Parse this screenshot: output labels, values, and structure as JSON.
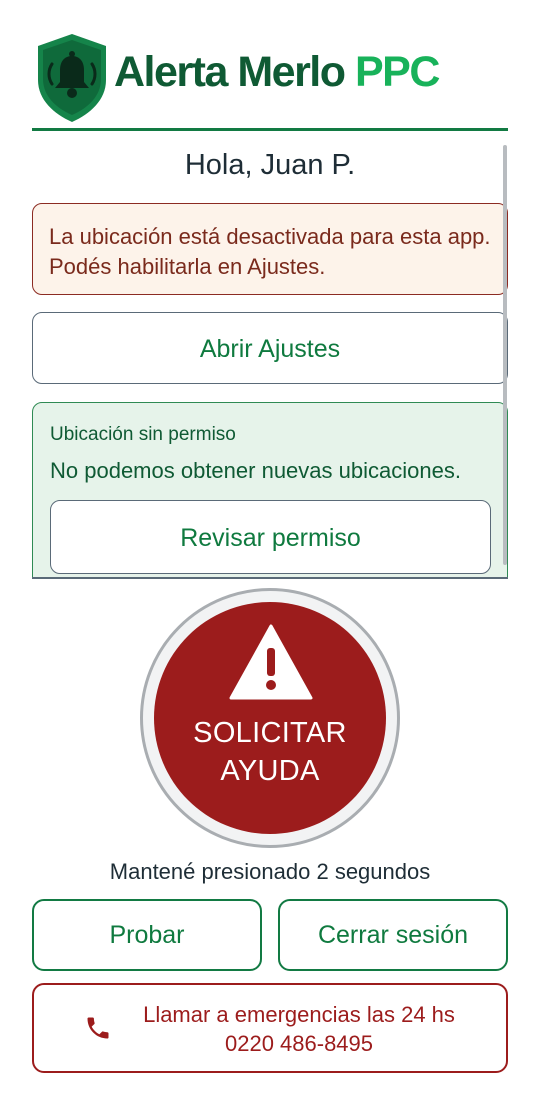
{
  "header": {
    "brand_name": "Alerta Merlo",
    "brand_tag": "PPC",
    "logo_icon": "bell-shield-icon"
  },
  "greeting": "Hola, Juan P.",
  "location_alert": {
    "text": "La ubicación está desactivada para esta app. Podés habilitarla en Ajustes."
  },
  "open_settings": {
    "label": "Abrir Ajustes"
  },
  "permission_card": {
    "title": "Ubicación sin permiso",
    "message": "No podemos obtener nuevas ubicaciones.",
    "button_label": "Revisar permiso"
  },
  "sos": {
    "icon": "warning-triangle-icon",
    "label_line1": "SOLICITAR",
    "label_line2": "AYUDA",
    "hint": "Mantené presionado 2 segundos"
  },
  "actions": {
    "test_label": "Probar",
    "logout_label": "Cerrar sesión"
  },
  "emergency": {
    "icon": "phone-icon",
    "line1": "Llamar a emergencias las 24 hs",
    "line2": "0220 486-8495"
  },
  "colors": {
    "brand_dark_green": "#0f5a34",
    "brand_light_green": "#18b25a",
    "accent_green": "#127a43",
    "danger_red": "#9c1c1c",
    "alert_bg": "#fdf3ea",
    "permission_bg": "#e6f3ea"
  }
}
